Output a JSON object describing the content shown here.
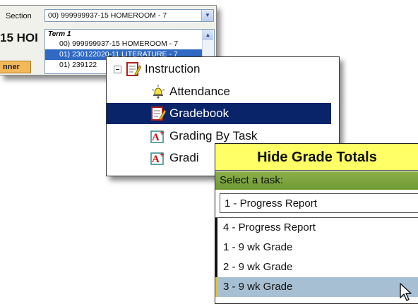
{
  "section_panel": {
    "label": "Section",
    "selected_value": "00) 999999937-15 HOMEROOM - 7",
    "header_fragment": "15 HOI",
    "tab_fragment": "nner",
    "list": {
      "group": "Term 1",
      "options": [
        "00) 999999937-15 HOMEROOM - 7",
        "01) 230122020-11 LITERATURE - 7",
        "01) 239122"
      ],
      "selected_index": 1
    }
  },
  "tree_panel": {
    "root": {
      "label": "Instruction",
      "icon": "instruction-icon"
    },
    "children": [
      {
        "label": "Attendance",
        "icon": "attendance-bell-icon"
      },
      {
        "label": "Gradebook",
        "icon": "gradebook-icon",
        "selected": true
      },
      {
        "label": "Grading By Task",
        "icon": "grade-a-plus-icon"
      },
      {
        "label": "Gradi",
        "icon": "grade-a-plus-icon"
      }
    ],
    "colors": {
      "selected_bg": "#0a246a",
      "selected_text": "#ffffff"
    }
  },
  "grade_panel": {
    "title": "Hide Grade Totals",
    "task_label": "Select a task:",
    "selected_task": "1 - Progress Report",
    "options": [
      "4 - Progress Report",
      "1 - 9 wk Grade",
      "2 - 9 wk Grade",
      "3 - 9 wk Grade"
    ],
    "hover_index": 3,
    "colors": {
      "title_bg": "#ffff66",
      "task_bar": "#7aa23c",
      "hover_bg": "#a7bfd2"
    }
  }
}
